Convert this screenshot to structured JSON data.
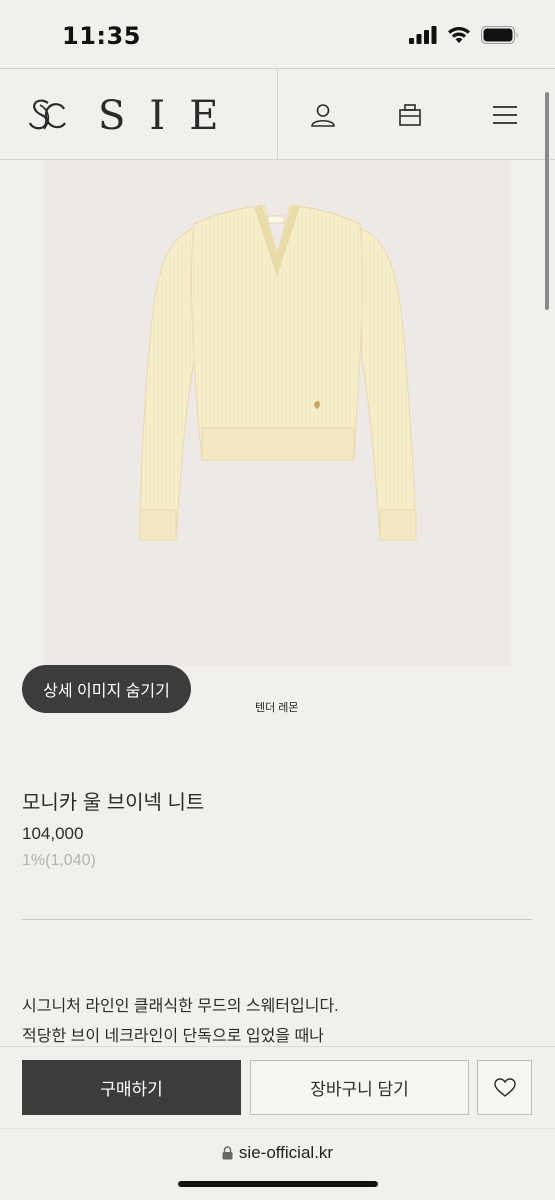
{
  "status_bar": {
    "time": "11:35"
  },
  "header": {
    "logo_text": "SIE"
  },
  "product": {
    "image_alt": "yellow v-neck knit sweater",
    "toggle_detail_label": "상세 이미지 숨기기",
    "color_name": "텐더 레몬",
    "name": "모니카 울 브이넥 니트",
    "price": "104,000",
    "points": "1%(1,040)",
    "description_lines": [
      "시그니처 라인인 클래식한 무드의 스웨터입니다.",
      "적당한 브이 네크라인이 단독으로 입었을 때나"
    ]
  },
  "actions": {
    "buy_label": "구매하기",
    "cart_label": "장바구니 담기"
  },
  "browser": {
    "url": "sie-official.kr"
  },
  "colors": {
    "accent": "#3c3c3c",
    "background": "#f1f0ec",
    "sweater": "#f7eecd"
  }
}
